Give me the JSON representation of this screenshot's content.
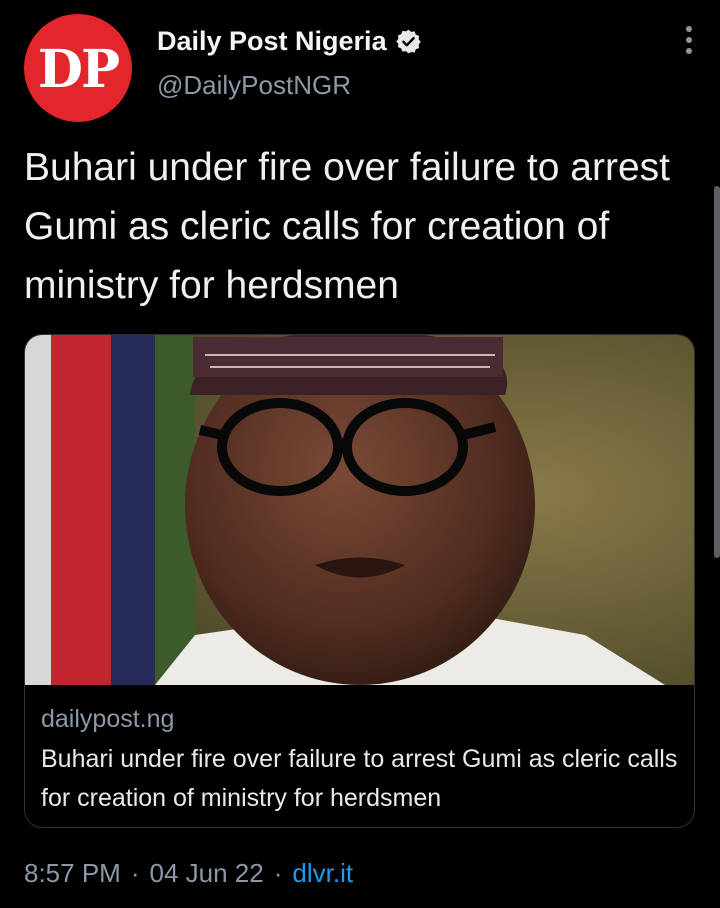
{
  "account": {
    "avatar_text": "DP",
    "name": "Daily Post Nigeria",
    "handle": "@DailyPostNGR",
    "verified": true
  },
  "tweet": {
    "text": "Buhari under fire over failure to arrest Gumi as cleric calls for creation of ministry for herdsmen"
  },
  "card": {
    "image_alt": "Portrait of Muhammadu Buhari in cap and glasses",
    "domain": "dailypost.ng",
    "title": "Buhari under fire over failure to arrest Gumi as cleric calls for creation of ministry for herdsmen"
  },
  "footer": {
    "time": "8:57 PM",
    "separator": "·",
    "date": "04 Jun 22",
    "source": "dlvr.it"
  },
  "colors": {
    "background": "#000000",
    "avatar": "#e3262c",
    "link": "#1d9bf0",
    "muted": "#8b98a5"
  },
  "icons": [
    "verified-badge-icon",
    "more-options-icon"
  ]
}
